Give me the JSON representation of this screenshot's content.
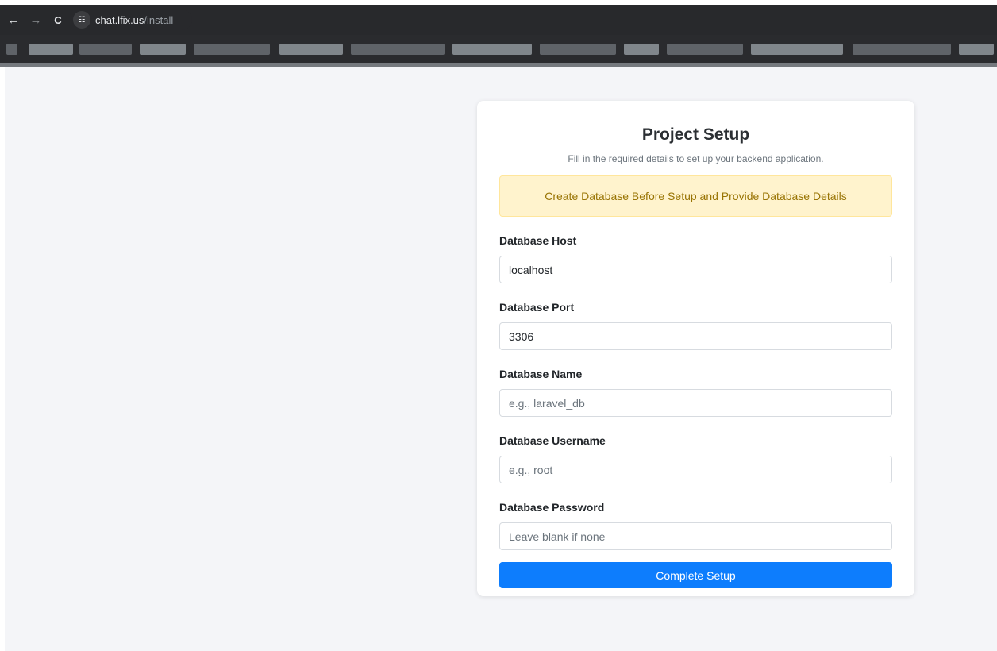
{
  "browser": {
    "back_icon": "←",
    "forward_icon": "→",
    "reload_icon": "C",
    "site_info_icon": "☷",
    "url_host": "chat.lfix.us",
    "url_path": "/install"
  },
  "form": {
    "title": "Project Setup",
    "subtitle": "Fill in the required details to set up your backend application.",
    "alert": "Create Database Before Setup and Provide Database Details",
    "fields": [
      {
        "label": "Database Host",
        "value": "localhost",
        "placeholder": ""
      },
      {
        "label": "Database Port",
        "value": "3306",
        "placeholder": ""
      },
      {
        "label": "Database Name",
        "value": "",
        "placeholder": "e.g., laravel_db"
      },
      {
        "label": "Database Username",
        "value": "",
        "placeholder": "e.g., root"
      },
      {
        "label": "Database Password",
        "value": "",
        "placeholder": "Leave blank if none"
      }
    ],
    "submit_label": "Complete Setup"
  },
  "colors": {
    "primary": "#0d7dfd",
    "alert_bg": "#fff3cd",
    "alert_text": "#997404",
    "page_bg": "#f4f5f8"
  }
}
